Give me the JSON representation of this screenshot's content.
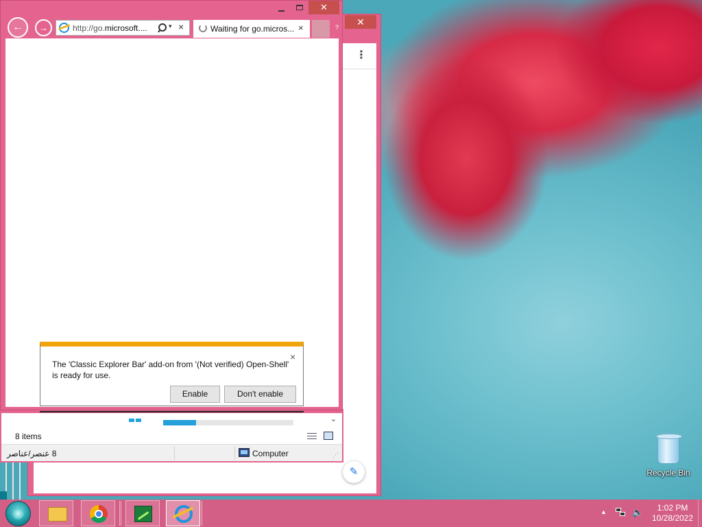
{
  "ie": {
    "address": "http://go.microsoft....",
    "address_prefix": "http://go.",
    "address_domain": "microsoft....",
    "tab_title": "Waiting for go.micros...",
    "tab_close": "×",
    "close_glyph": "✕"
  },
  "notification": {
    "message": "The 'Classic Explorer Bar' add-on from '(Not verified) Open-Shell' is ready for use.",
    "enable_label": "Enable",
    "dont_enable_label": "Don't enable",
    "close_glyph": "×"
  },
  "explorer": {
    "items_count": "8 items",
    "status_items_arabic": "8 عنصر/عناصر",
    "location": "Computer",
    "progress_fraction": 0.25
  },
  "desktop": {
    "recycle_bin_label": "Recycle Bin"
  },
  "background_window": {
    "menu_dots": "⋮",
    "edit_glyph": "✎"
  },
  "taskbar": {
    "pinned": [
      "file-explorer-icon",
      "chrome-icon",
      "task-manager-icon",
      "internet-explorer-icon"
    ],
    "clock_time": "1:02 PM",
    "clock_date": "10/28/2022"
  },
  "colors": {
    "window_frame": "#e4648f",
    "close_button": "#c7504f",
    "notification_accent": "#f0a30a",
    "taskbar": "#d45f86",
    "progress": "#26a0da"
  }
}
